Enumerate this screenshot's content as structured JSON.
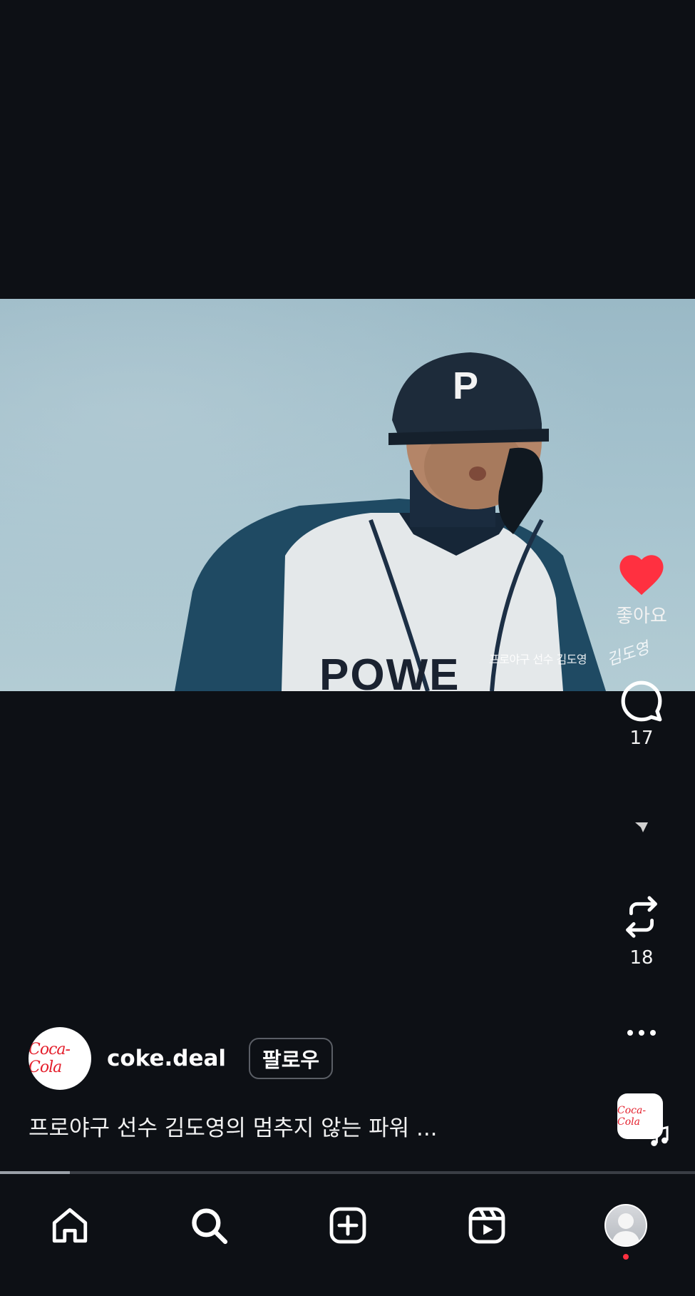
{
  "video": {
    "overlay_caption": "프로야구 선수 김도영",
    "signature_text": "김도영"
  },
  "actions": {
    "like_label": "좋아요",
    "like_color": "#ff3040",
    "comment_count": "17",
    "repost_count": "18"
  },
  "account": {
    "username": "coke.deal",
    "follow_label": "팔로우",
    "avatar_logo_text": "Coca-Cola"
  },
  "description": "프로야구 선수 김도영의 멈추지 않는 파워 ...",
  "music": {
    "thumb_logo_text": "Coca-Cola"
  },
  "playback": {
    "progress_fraction": 0.1
  },
  "nav": {
    "items": [
      {
        "icon": "home-icon"
      },
      {
        "icon": "search-icon"
      },
      {
        "icon": "create-icon"
      },
      {
        "icon": "reels-icon"
      },
      {
        "icon": "profile-icon",
        "has_notification_dot": true
      }
    ]
  }
}
